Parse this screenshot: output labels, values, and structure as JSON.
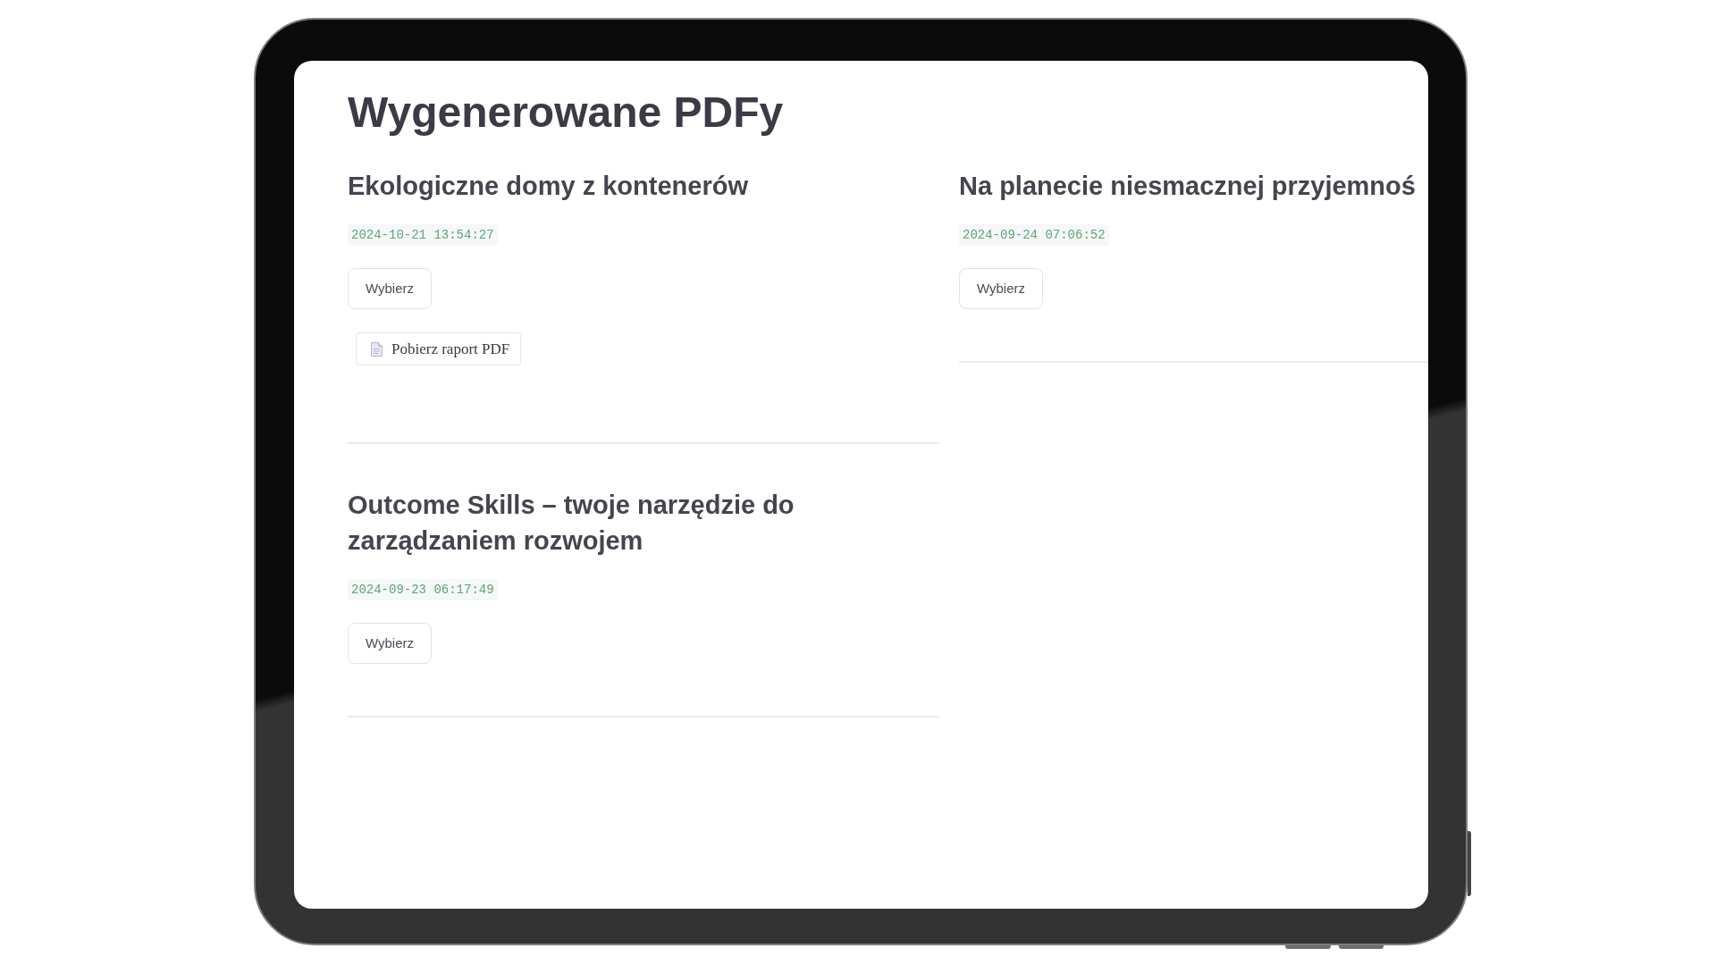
{
  "page_title": "Wygenerowane PDFy",
  "columns": [
    {
      "items": [
        {
          "title": "Ekologiczne domy z kontenerów",
          "timestamp": "2024-10-21 13:54:27",
          "select_button": "Wybierz",
          "download_button": "Pobierz raport PDF"
        },
        {
          "title": "Outcome Skills – twoje narzędzie do zarządzaniem rozwojem",
          "timestamp": "2024-09-23 06:17:49",
          "select_button": "Wybierz"
        }
      ]
    },
    {
      "items": [
        {
          "title": "Na planecie niesmacznej przyjemnoś",
          "timestamp": "2024-09-24 07:06:52",
          "select_button": "Wybierz"
        }
      ]
    }
  ]
}
